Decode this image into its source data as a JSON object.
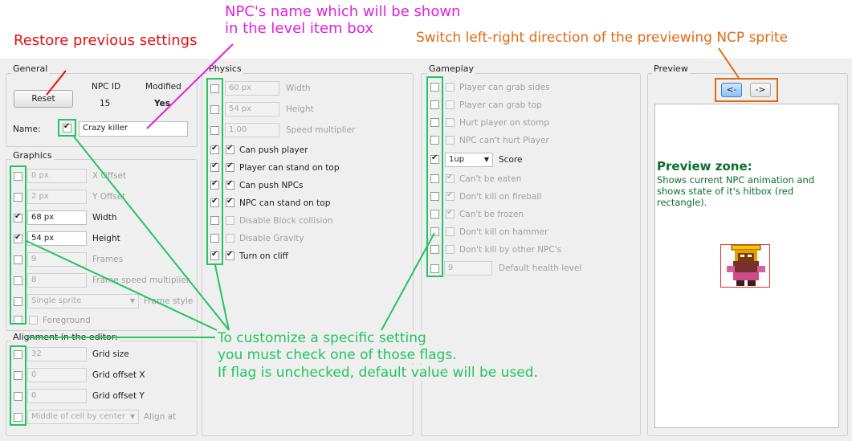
{
  "annotations": {
    "restore": "Restore previous settings",
    "npc_name_line1": "NPC's name which will be shown",
    "npc_name_line2": "in the level item box",
    "switch_dir": "Switch left-right direction of the previewing NCP sprite",
    "customize_line1": "To customize a specific setting",
    "customize_line2": "you must check one of those flags.",
    "customize_line3": "If flag is unchecked, default value will be used.",
    "preview_title": "Preview zone:",
    "preview_desc1": "Shows current NPC animation and",
    "preview_desc2": "shows state of it's hitbox (red",
    "preview_desc3": "rectangle)."
  },
  "colors": {
    "red_annotation": "#e01010",
    "magenta_annotation": "#e020e0",
    "orange_annotation": "#e06a10",
    "green_annotation": "#22c55e",
    "preview_text": "#0b6e2a"
  },
  "general": {
    "title": "General",
    "reset": "Reset",
    "npc_id_label": "NPC ID",
    "npc_id": "15",
    "modified_label": "Modified",
    "modified": "Yes",
    "name_label": "Name:",
    "name_value": "Crazy killer"
  },
  "graphics": {
    "title": "Graphics",
    "x_offset": "0 px",
    "x_offset_label": "X Offset",
    "y_offset": "2 px",
    "y_offset_label": "Y Offset",
    "width": "68 px",
    "width_label": "Width",
    "height": "54 px",
    "height_label": "Height",
    "frames": "9",
    "frames_label": "Frames",
    "frame_speed": "8",
    "frame_speed_label": "Frame speed multiplier",
    "frame_style": "Single sprite",
    "frame_style_label": "Frame style",
    "foreground_label": "Foreground"
  },
  "alignment": {
    "title": "Alignment in the editor:",
    "grid_size": "32",
    "grid_size_label": "Grid size",
    "grid_offset_x": "0",
    "grid_offset_x_label": "Grid offset X",
    "grid_offset_y": "0",
    "grid_offset_y_label": "Grid offset Y",
    "align_at": "Middle of cell by center",
    "align_at_label": "Align at"
  },
  "physics": {
    "title": "Physics",
    "width": "60 px",
    "width_label": "Width",
    "height": "54 px",
    "height_label": "Height",
    "speed": "1.00",
    "speed_label": "Speed multiplier",
    "can_push_player": "Can push player",
    "player_stand": "Player can stand on top",
    "can_push_npcs": "Can push NPCs",
    "npc_stand": "NPC can stand on top",
    "disable_block": "Disable Block collision",
    "disable_gravity": "Disable Gravity",
    "turn_on_cliff": "Turn on cliff"
  },
  "gameplay": {
    "title": "Gameplay",
    "grab_sides": "Player can grab sides",
    "grab_top": "Player can grab top",
    "hurt_stomp": "Hurt player on stomp",
    "cant_hurt": "NPC can't hurt Player",
    "score_value": "1up",
    "score_label": "Score",
    "cant_eaten": "Can't be eaten",
    "dont_kill_fireball": "Don't kill on fireball",
    "cant_frozen": "Can't be frozen",
    "dont_kill_hammer": "Don't kill on hammer",
    "dont_kill_other": "Don't kill by other NPC's",
    "health": "9",
    "health_label": "Default health level"
  },
  "preview": {
    "title": "Preview",
    "left_btn": "<-",
    "right_btn": "->"
  }
}
